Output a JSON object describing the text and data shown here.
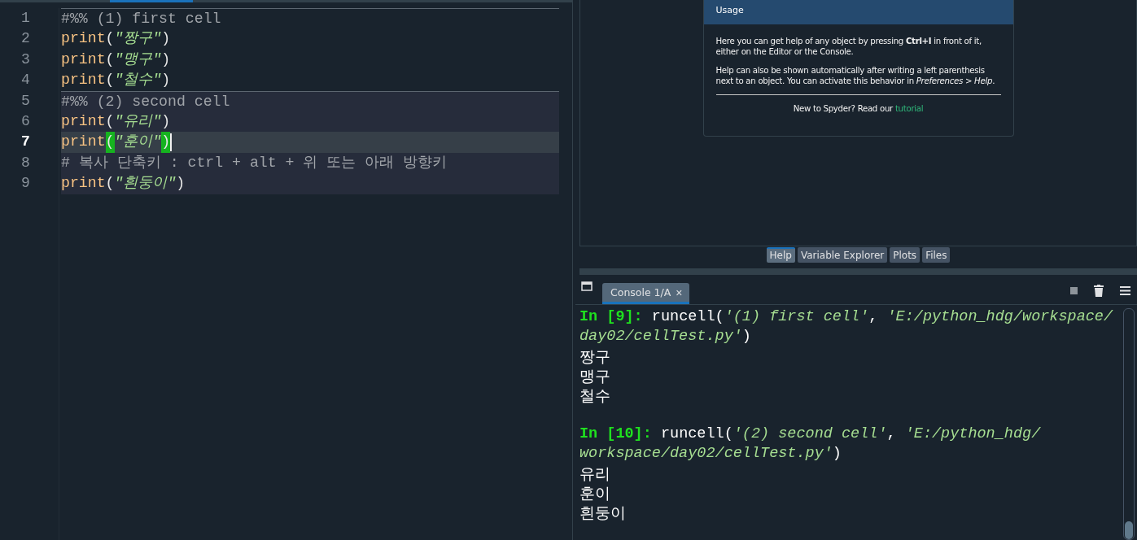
{
  "editor": {
    "lines": [
      {
        "number": "1",
        "current": false,
        "in_active_cell": false,
        "cell_start": true,
        "tokens": [
          {
            "kind": "comment",
            "text": "#%% (1) first cell"
          }
        ]
      },
      {
        "number": "2",
        "current": false,
        "in_active_cell": false,
        "cell_start": false,
        "tokens": [
          {
            "kind": "keyword",
            "text": "print"
          },
          {
            "kind": "punct",
            "text": "("
          },
          {
            "kind": "string",
            "text": "\"짱구\""
          },
          {
            "kind": "punct",
            "text": ")"
          }
        ]
      },
      {
        "number": "3",
        "current": false,
        "in_active_cell": false,
        "cell_start": false,
        "tokens": [
          {
            "kind": "keyword",
            "text": "print"
          },
          {
            "kind": "punct",
            "text": "("
          },
          {
            "kind": "string",
            "text": "\"맹구\""
          },
          {
            "kind": "punct",
            "text": ")"
          }
        ]
      },
      {
        "number": "4",
        "current": false,
        "in_active_cell": false,
        "cell_start": false,
        "tokens": [
          {
            "kind": "keyword",
            "text": "print"
          },
          {
            "kind": "punct",
            "text": "("
          },
          {
            "kind": "string",
            "text": "\"철수\""
          },
          {
            "kind": "punct",
            "text": ")"
          }
        ]
      },
      {
        "number": "5",
        "current": false,
        "in_active_cell": true,
        "cell_start": true,
        "tokens": [
          {
            "kind": "comment",
            "text": "#%% (2) second cell"
          }
        ]
      },
      {
        "number": "6",
        "current": false,
        "in_active_cell": true,
        "cell_start": false,
        "tokens": [
          {
            "kind": "keyword",
            "text": "print"
          },
          {
            "kind": "punct",
            "text": "("
          },
          {
            "kind": "string",
            "text": "\"유리\""
          },
          {
            "kind": "punct",
            "text": ")"
          }
        ]
      },
      {
        "number": "7",
        "current": true,
        "in_active_cell": true,
        "cell_start": false,
        "tokens": [
          {
            "kind": "keyword",
            "text": "print"
          },
          {
            "kind": "bracket_match",
            "text": "("
          },
          {
            "kind": "string",
            "text": "\"훈이\""
          },
          {
            "kind": "bracket_match",
            "text": ")"
          }
        ]
      },
      {
        "number": "8",
        "current": false,
        "in_active_cell": true,
        "cell_start": false,
        "tokens": [
          {
            "kind": "comment",
            "text": "# 복사 단축키 : ctrl + alt + 위 또는 아래 방향키"
          }
        ]
      },
      {
        "number": "9",
        "current": false,
        "in_active_cell": true,
        "cell_start": false,
        "tokens": [
          {
            "kind": "keyword",
            "text": "print"
          },
          {
            "kind": "punct",
            "text": "("
          },
          {
            "kind": "string",
            "text": "\"흰둥이\""
          },
          {
            "kind": "punct",
            "text": ")"
          }
        ]
      }
    ]
  },
  "help": {
    "header": "Usage",
    "paragraph_1": "Here you can get help of any object by pressing **Ctrl+I** in front of it, either on the Editor or the Console.",
    "paragraph_2": "Help can also be shown automatically after writing a left parenthesis next to an object. You can activate this behavior in *Preferences > Help*.",
    "footer_text": "New to Spyder? Read our",
    "footer_link": "tutorial"
  },
  "pane_tabs": [
    {
      "label": "Help",
      "selected": true
    },
    {
      "label": "Variable Explorer",
      "selected": false
    },
    {
      "label": "Plots",
      "selected": false
    },
    {
      "label": "Files",
      "selected": false
    }
  ],
  "console": {
    "tab": {
      "label": "Console 1/A",
      "close": "×"
    },
    "lines": [
      {
        "kind": "text",
        "segments": [
          {
            "kind": "prompt",
            "text": "In [9]:"
          },
          {
            "kind": "code",
            "text": " runcell("
          },
          {
            "kind": "string",
            "text": "'(1) first cell'"
          },
          {
            "kind": "code",
            "text": ", "
          },
          {
            "kind": "string",
            "text": "'E:/python_hdg/workspace/"
          }
        ]
      },
      {
        "kind": "text",
        "segments": [
          {
            "kind": "string",
            "text": "day02/cellTest.py'"
          },
          {
            "kind": "code",
            "text": ")"
          }
        ]
      },
      {
        "kind": "text",
        "segments": [
          {
            "kind": "output",
            "text": "짱구"
          }
        ]
      },
      {
        "kind": "text",
        "segments": [
          {
            "kind": "output",
            "text": "맹구"
          }
        ]
      },
      {
        "kind": "text",
        "segments": [
          {
            "kind": "output",
            "text": "철수"
          }
        ]
      },
      {
        "kind": "blank"
      },
      {
        "kind": "text",
        "segments": [
          {
            "kind": "prompt",
            "text": "In [10]:"
          },
          {
            "kind": "code",
            "text": " runcell("
          },
          {
            "kind": "string",
            "text": "'(2) second cell'"
          },
          {
            "kind": "code",
            "text": ", "
          },
          {
            "kind": "string",
            "text": "'E:/python_hdg/"
          }
        ]
      },
      {
        "kind": "text",
        "segments": [
          {
            "kind": "string",
            "text": "workspace/day02/cellTest.py'"
          },
          {
            "kind": "code",
            "text": ")"
          }
        ]
      },
      {
        "kind": "text",
        "segments": [
          {
            "kind": "output",
            "text": "유리"
          }
        ]
      },
      {
        "kind": "text",
        "segments": [
          {
            "kind": "output",
            "text": "훈이"
          }
        ]
      },
      {
        "kind": "text",
        "segments": [
          {
            "kind": "output",
            "text": "흰둥이"
          }
        ]
      }
    ]
  }
}
